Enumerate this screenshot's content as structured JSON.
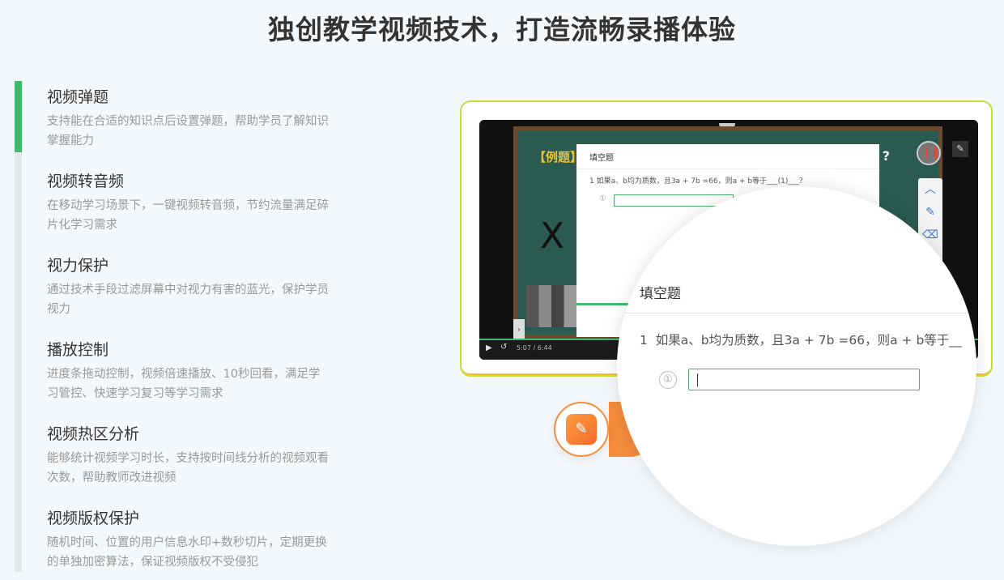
{
  "page": {
    "title": "独创教学视频技术，打造流畅录播体验"
  },
  "features": [
    {
      "title": "视频弹题",
      "desc": "支持能在合适的知识点后设置弹题，帮助学员了解知识掌握能力",
      "active": true
    },
    {
      "title": "视频转音频",
      "desc": "在移动学习场景下，一键视频转音频，节约流量满足碎片化学习需求"
    },
    {
      "title": "视力保护",
      "desc": "通过技术手段过滤屏幕中对视力有害的蓝光，保护学员视力"
    },
    {
      "title": "播放控制",
      "desc": "进度条拖动控制，视频倍速播放、10秒回看，满足学习管控、快速学习复习等学习需求"
    },
    {
      "title": "视频热区分析",
      "desc": "能够统计视频学习时长，支持按时间线分析的视频观看次数，帮助教师改进视频"
    },
    {
      "title": "视频版权保护",
      "desc": "随机时间、位置的用户信息水印+数秒切片，定期更换的单独加密算法，保证视频版权不受侵犯"
    }
  ],
  "video": {
    "example_tag": "【例题】",
    "board_mark": "X",
    "board_q": "?",
    "time": "5:07 / 6:44",
    "quiz": {
      "type_label": "填空题",
      "question": "1  如果a、b均为质数，且3a + 7b =66，则a + b等于___(1)___？",
      "answer_index": "①"
    }
  },
  "magnifier": {
    "type_label": "填空题",
    "question_number": "1",
    "question": "如果a、b均为质数，且3a + 7b =66，则a + b等于__",
    "answer_index": "①"
  },
  "icons": {
    "play": "▶",
    "replay": "↺",
    "pen": "✎",
    "eraser": "⌫",
    "up": "︿",
    "note": "✎",
    "left": "›"
  },
  "colors": {
    "accent_green": "#3fba6f",
    "accent_orange": "#f58d3c"
  }
}
